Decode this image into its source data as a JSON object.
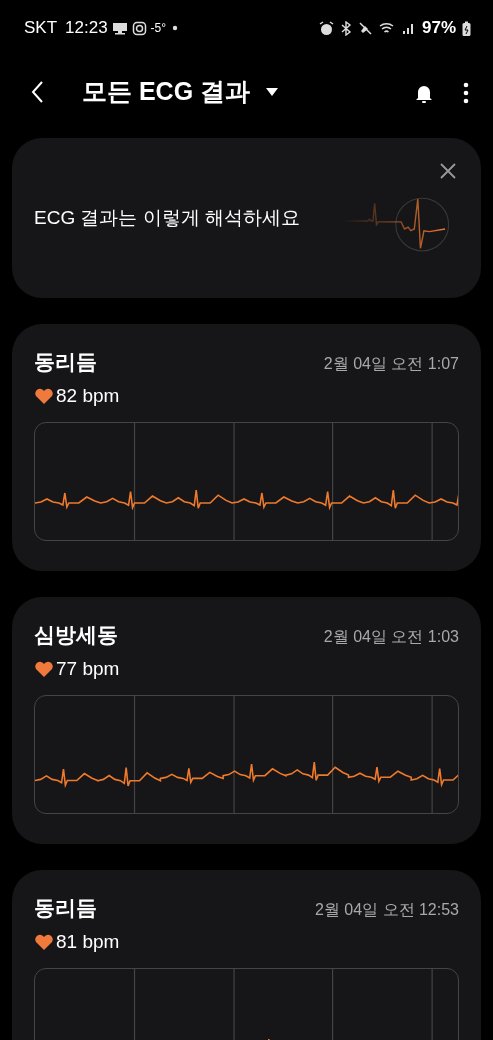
{
  "status_bar": {
    "carrier": "SKT",
    "time": "12:23",
    "temperature": "-5°",
    "battery": "97%"
  },
  "header": {
    "title": "모든 ECG 결과"
  },
  "banner": {
    "text": "ECG 결과는 이렇게 해석하세요"
  },
  "records": [
    {
      "title": "동리듬",
      "date": "2월 04일 오전 1:07",
      "bpm": "82 bpm"
    },
    {
      "title": "심방세동",
      "date": "2월 04일 오전 1:03",
      "bpm": "77 bpm"
    },
    {
      "title": "동리듬",
      "date": "2월 04일 오전 12:53",
      "bpm": "81 bpm"
    }
  ]
}
